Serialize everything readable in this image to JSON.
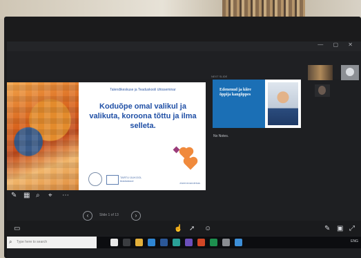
{
  "app": {
    "title_left": "",
    "window_controls": "— ▢ ✕"
  },
  "menu": {
    "items": [
      "",
      "",
      ""
    ]
  },
  "current_slide": {
    "subtitle": "Talendikeskuse ja Teaduskooli ühisseminar",
    "headline": "Koduõpe omal valikul ja valikuta, koroona tõttu ja ilma selleta.",
    "logo_text_line1": "TARTU ÜLIKOOL",
    "logo_text_line2": "teaduskool",
    "heart_note": "",
    "hashtag": "#arenevandekas"
  },
  "navigation": {
    "prev_icon": "‹",
    "next_icon": "›",
    "slide_label": "Slide 1 of 13"
  },
  "next_slide": {
    "header": "NEXT SLIDE",
    "title": "Edenenud ja kiire õppija kangõppes",
    "footer": ""
  },
  "notes": {
    "text": "No Notes."
  },
  "taskbar": {
    "search_placeholder": "Type here to search",
    "tray_text": "ENG"
  },
  "colors": {
    "accent_blue": "#1f4fa5",
    "next_slide_blue": "#1b6fb5",
    "heart_orange": "#f08a3c"
  },
  "icons": {
    "pen": "pen-icon",
    "grid": "grid-icon",
    "zoom": "magnifier-icon",
    "pointer": "pointer-icon",
    "more": "more-icon"
  }
}
